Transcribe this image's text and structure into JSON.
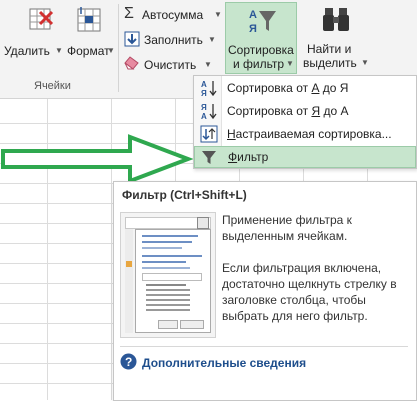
{
  "ribbon": {
    "cells_group": {
      "delete_label": "Удалить",
      "format_label": "Формат",
      "group_label": "Ячейки"
    },
    "editing": {
      "autosum_label": "Автосумма",
      "fill_label": "Заполнить",
      "clear_label": "Очистить",
      "sort_filter_line1": "Сортировка",
      "sort_filter_line2": "и фильтр",
      "find_line1": "Найти и",
      "find_line2": "выделить"
    }
  },
  "sort_menu": {
    "items": [
      {
        "prefix": "Сортировка от ",
        "key": "А",
        "suffix": " до Я"
      },
      {
        "prefix": "Сортировка от ",
        "key": "Я",
        "suffix": " до А"
      },
      {
        "prefix": "",
        "key": "Н",
        "suffix": "астраиваемая сортировка..."
      },
      {
        "prefix": "",
        "key": "Ф",
        "suffix": "ильтр"
      }
    ],
    "highlighted_item": "Фильтр"
  },
  "tooltip": {
    "title": "Фильтр (Ctrl+Shift+L)",
    "paragraph1": "Применение фильтра к выделенным ячейкам.",
    "paragraph2": "Если фильтрация включена, достаточно щелкнуть стрелку в заголовке столбца, чтобы выбрать для него фильтр.",
    "more_info_link": "Дополнительные сведения"
  },
  "colors": {
    "ribbon_bg": "#f3f3f3",
    "highlight_bg": "#c7e5cd",
    "arrow_green": "#2fa84f",
    "link_blue": "#1e4e8c",
    "accent_red": "#c0392b",
    "accent_blue": "#2b5797"
  },
  "icons": [
    "delete-cells-icon",
    "format-cells-icon",
    "autosum-icon",
    "fill-icon",
    "eraser-icon",
    "sort-filter-icon",
    "binoculars-icon",
    "sort-az-icon",
    "sort-za-icon",
    "custom-sort-icon",
    "funnel-icon",
    "help-icon"
  ]
}
